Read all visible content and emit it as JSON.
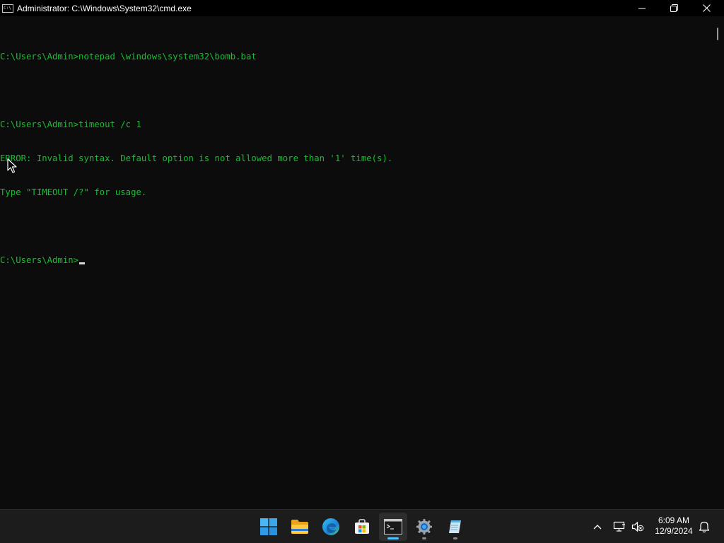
{
  "window": {
    "title": "Administrator: C:\\Windows\\System32\\cmd.exe",
    "icon_text": "C:\\",
    "controls": {
      "minimize": "minimize-icon",
      "maximize": "restore-icon",
      "close": "close-icon"
    }
  },
  "console": {
    "text_color": "#13c12e",
    "background": "#0c0c0c",
    "lines": [
      "C:\\Users\\Admin>notepad \\windows\\system32\\bomb.bat",
      "",
      "C:\\Users\\Admin>timeout /c 1",
      "ERROR: Invalid syntax. Default option is not allowed more than '1' time(s).",
      "Type \"TIMEOUT /?\" for usage.",
      "",
      "C:\\Users\\Admin>"
    ]
  },
  "taskbar": {
    "apps": [
      {
        "name": "start",
        "icon": "windows-start-icon"
      },
      {
        "name": "file-explorer",
        "icon": "folder-icon"
      },
      {
        "name": "edge",
        "icon": "edge-browser-icon"
      },
      {
        "name": "store",
        "icon": "store-icon"
      },
      {
        "name": "command-prompt",
        "icon": "terminal-icon",
        "active": true
      },
      {
        "name": "settings",
        "icon": "gear-icon"
      },
      {
        "name": "notepad",
        "icon": "notepad-icon"
      }
    ],
    "tray": {
      "icons": [
        "chevron-up-icon",
        "network-icon",
        "volume-muted-icon",
        "bell-icon"
      ],
      "time": "6:09 AM",
      "date": "12/9/2024"
    }
  }
}
